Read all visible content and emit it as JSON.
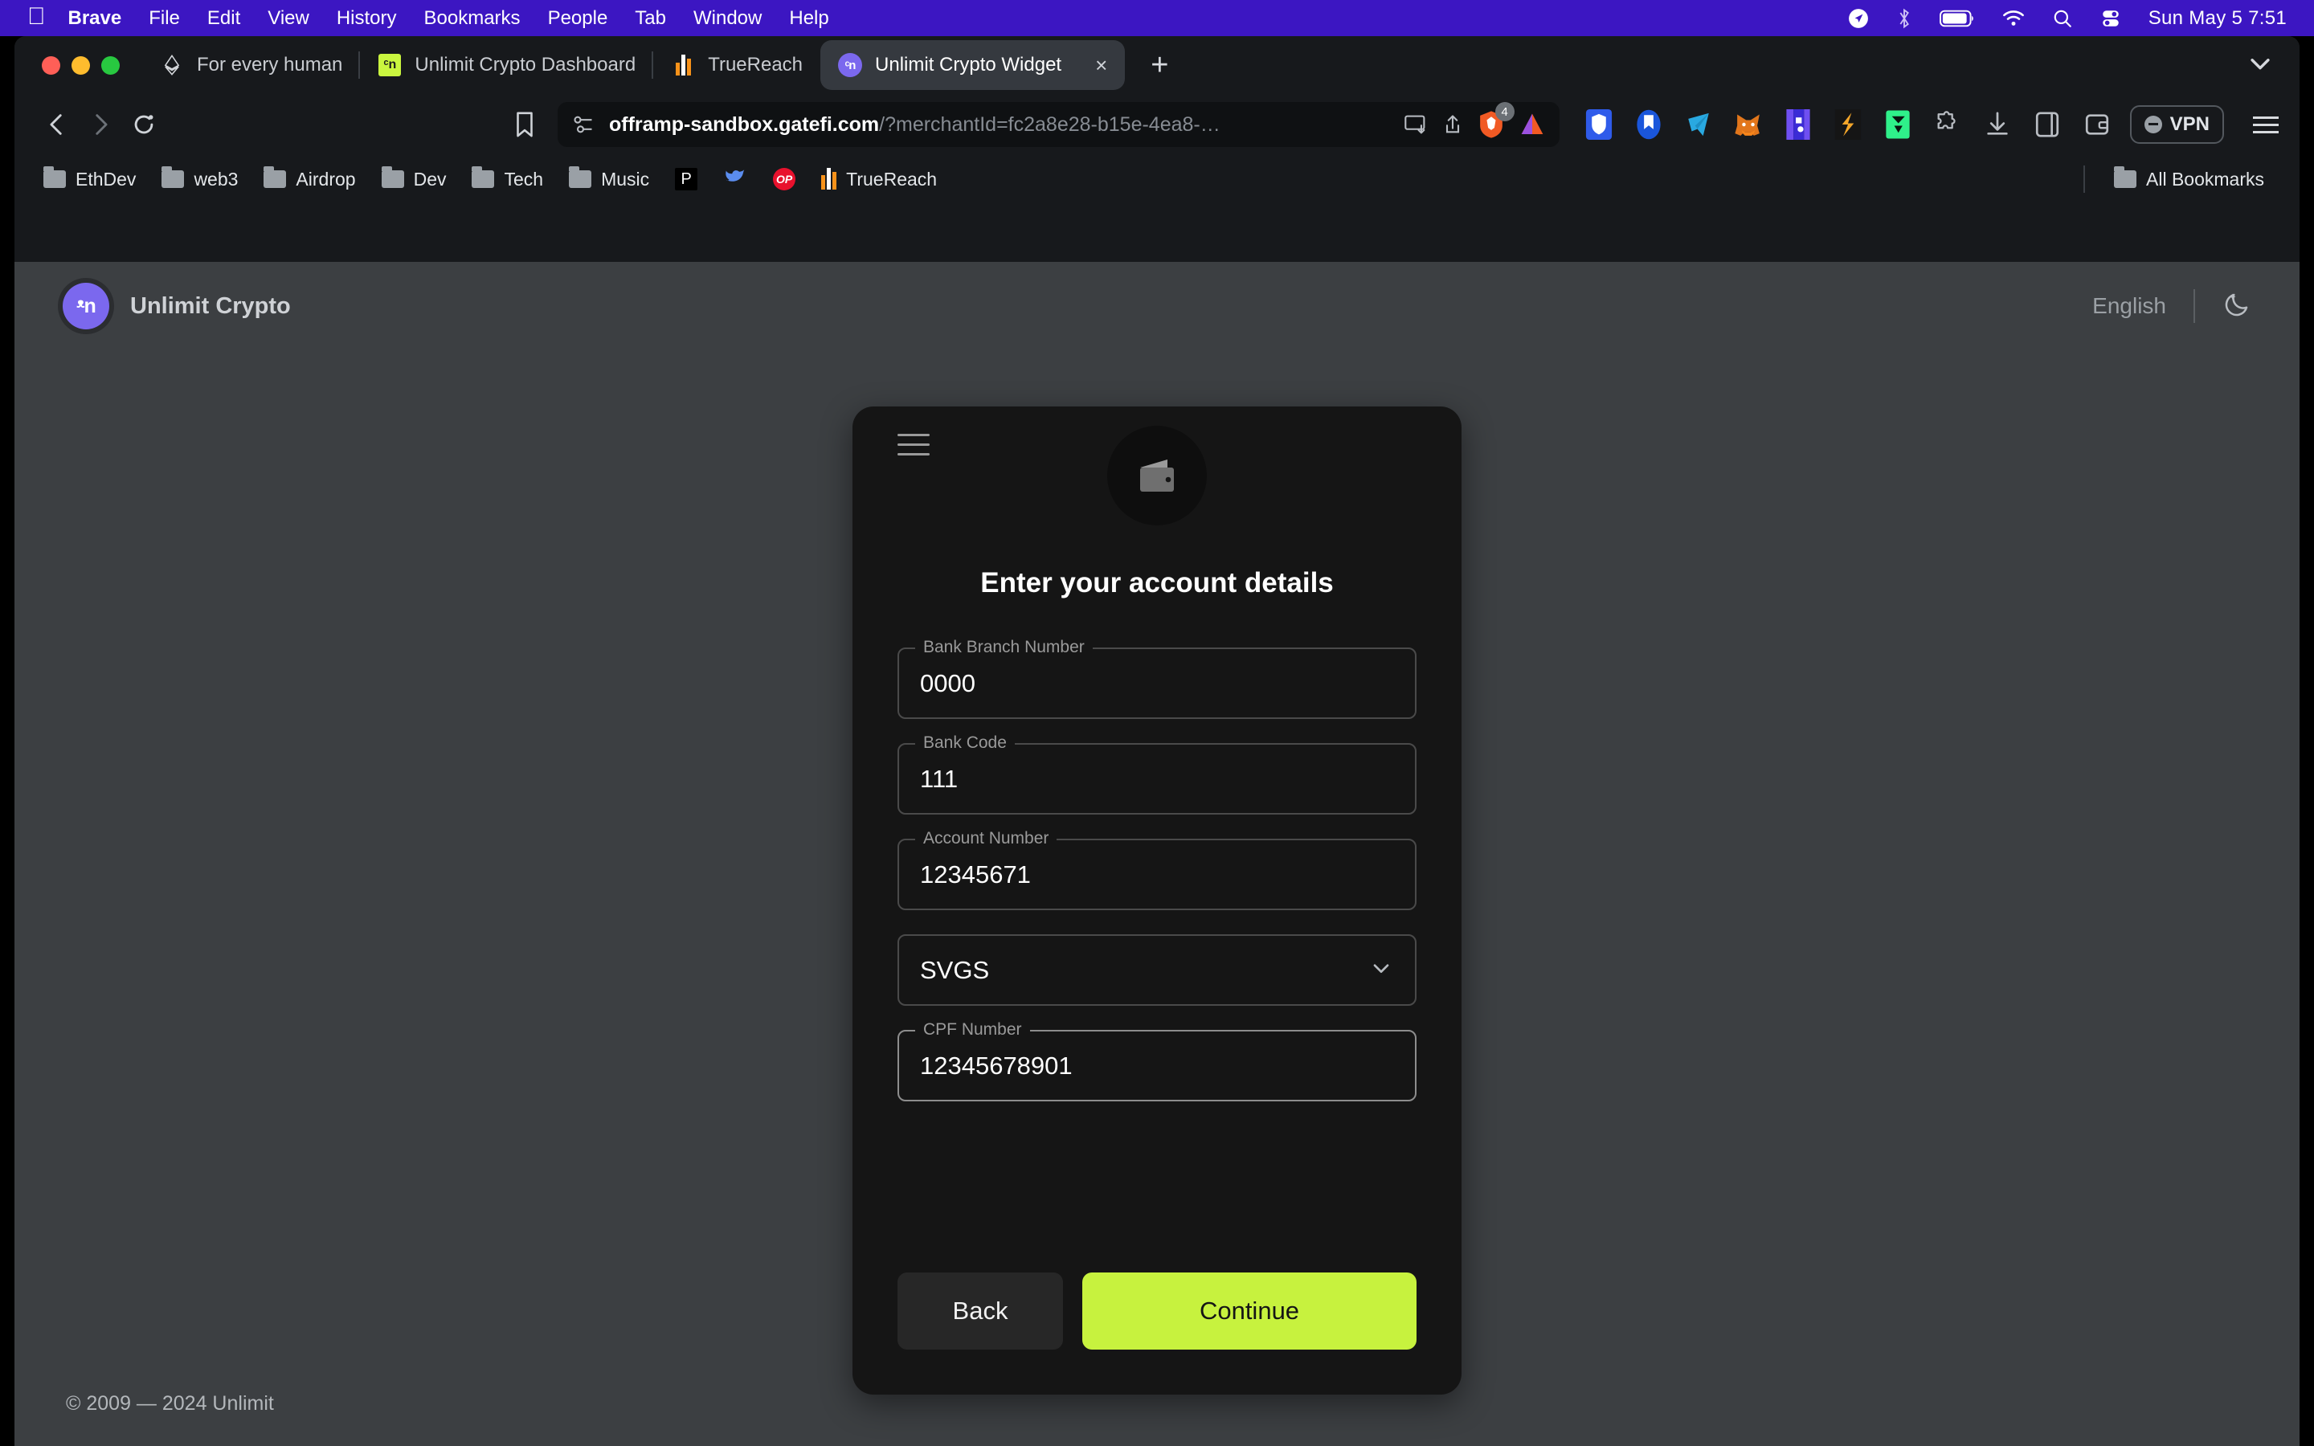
{
  "menubar": {
    "app_name": "Brave",
    "items": [
      "File",
      "Edit",
      "View",
      "History",
      "Bookmarks",
      "People",
      "Tab",
      "Window",
      "Help"
    ],
    "status_icons": [
      "location-icon",
      "bluetooth-icon",
      "battery-icon",
      "wifi-icon",
      "spotlight-search-icon",
      "control-center-icon"
    ],
    "clock": "Sun May 5  7:51"
  },
  "browser": {
    "tabs": [
      {
        "title": "For every human",
        "favicon": "ethereum-icon",
        "active": false
      },
      {
        "title": "Unlimit Crypto Dashboard",
        "favicon": "unlimit-green-icon",
        "active": false
      },
      {
        "title": "TrueReach",
        "favicon": "truereach-bars-icon",
        "active": false
      },
      {
        "title": "Unlimit Crypto Widget",
        "favicon": "unlimit-purple-icon",
        "active": true
      }
    ],
    "new_tab_label": "+",
    "close_tab_label": "×",
    "nav": {
      "back": "back-arrow",
      "forward": "forward-arrow",
      "reload": "reload-icon",
      "bookmark": "bookmark-icon"
    },
    "omnibox": {
      "host": "offramp-sandbox.gatefi.com",
      "path": "/?merchantId=fc2a8e28-b15e-4ea8-…",
      "site_settings_icon": "permissions-icon",
      "cast_icon": "cast-icon",
      "share_icon": "share-icon",
      "brave_shields_count": "4"
    },
    "extensions": [
      "shield-extension-icon",
      "bookmark-extension-icon",
      "telegram-wallet-icon",
      "metamask-fox-icon",
      "blockchain-extension-icon",
      "snapshot-icon",
      "green-arrow-wallet-icon",
      "puzzle-extensions-icon",
      "download-icon",
      "sidebar-icon",
      "wallet-icon"
    ],
    "vpn_label": "VPN",
    "menu_icon": "hamburger-menu-icon",
    "bookmarks": [
      {
        "label": "EthDev",
        "icon": "folder-icon"
      },
      {
        "label": "web3",
        "icon": "folder-icon"
      },
      {
        "label": "Airdrop",
        "icon": "folder-icon"
      },
      {
        "label": "Dev",
        "icon": "folder-icon"
      },
      {
        "label": "Tech",
        "icon": "folder-icon"
      },
      {
        "label": "Music",
        "icon": "folder-icon"
      },
      {
        "label": "",
        "icon": "p-site-icon"
      },
      {
        "label": "",
        "icon": "blue-bird-icon"
      },
      {
        "label": "",
        "icon": "op-site-icon"
      },
      {
        "label": "TrueReach",
        "icon": "truereach-bars-icon"
      }
    ],
    "all_bookmarks_label": "All Bookmarks"
  },
  "widget": {
    "brand_name": "Unlimit Crypto",
    "brand_logo_text": "ᵜn",
    "language": "English",
    "theme_toggle_icon": "moon-icon",
    "menu_icon": "hamburger-menu-icon",
    "hero_icon": "wallet-icon",
    "title": "Enter your account details",
    "fields": [
      {
        "label": "Bank Branch Number",
        "value": "0000",
        "type": "text",
        "focused": false
      },
      {
        "label": "Bank Code",
        "value": "111",
        "type": "text",
        "focused": false
      },
      {
        "label": "Account Number",
        "value": "12345671",
        "type": "text",
        "focused": false
      },
      {
        "label": "",
        "value": "SVGS",
        "type": "select",
        "focused": false
      },
      {
        "label": "CPF Number",
        "value": "12345678901",
        "type": "text",
        "focused": true
      }
    ],
    "back_label": "Back",
    "continue_label": "Continue",
    "accent_color": "#c7f23e",
    "footer": "© 2009 — 2024 Unlimit"
  }
}
